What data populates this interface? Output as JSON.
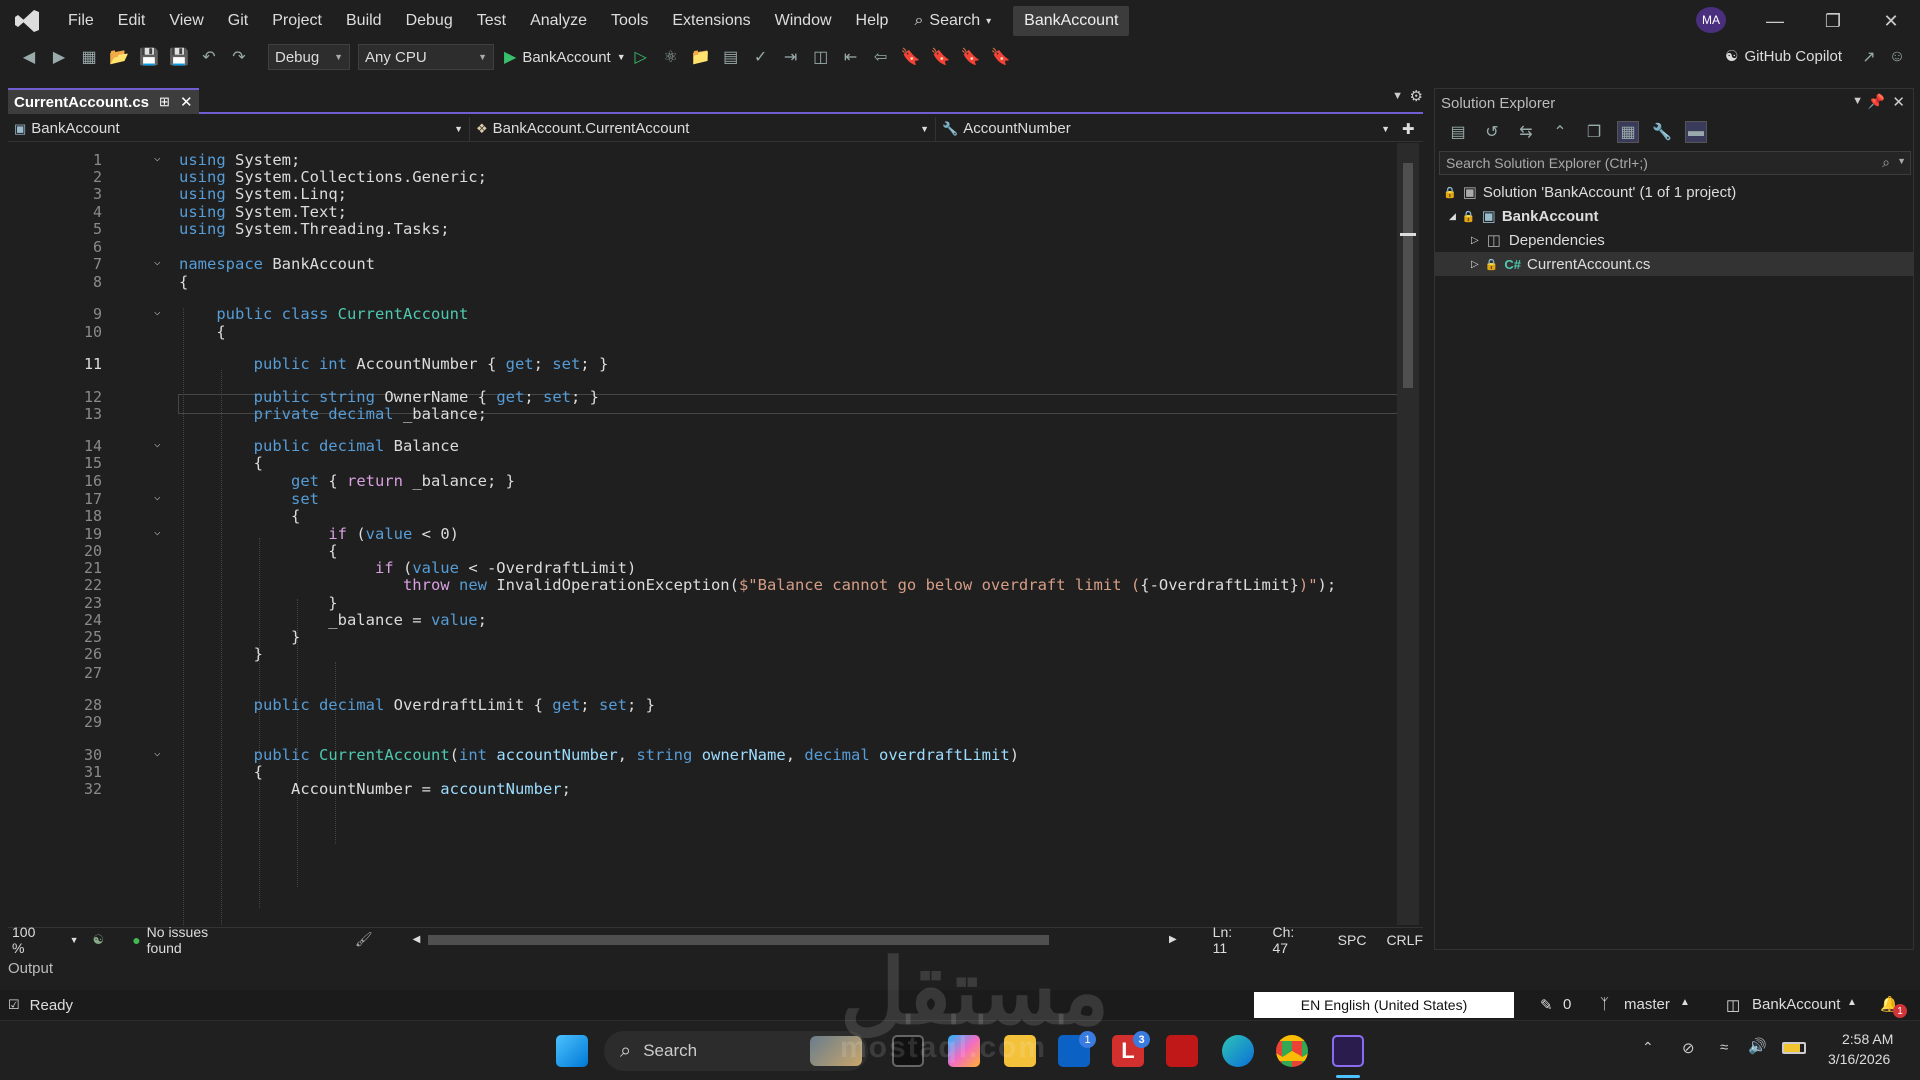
{
  "menu": {
    "items": [
      "File",
      "Edit",
      "View",
      "Git",
      "Project",
      "Build",
      "Debug",
      "Test",
      "Analyze",
      "Tools",
      "Extensions",
      "Window",
      "Help"
    ],
    "search_label": "Search",
    "solution_name": "BankAccount",
    "avatar_initials": "MA"
  },
  "toolbar": {
    "config": "Debug",
    "platform": "Any CPU",
    "run_target": "BankAccount",
    "copilot_label": "GitHub Copilot"
  },
  "editor": {
    "tab_title": "CurrentAccount.cs",
    "nav_project": "BankAccount",
    "nav_type": "BankAccount.CurrentAccount",
    "nav_member": "AccountNumber",
    "zoom": "100 %",
    "issues": "No issues found",
    "line": "Ln: 11",
    "column": "Ch: 47",
    "whitespace": "SPC",
    "line_endings": "CRLF",
    "current_line_number": 11
  },
  "code_lines": [
    {
      "n": 1,
      "fold": true,
      "tokens": [
        [
          "kw",
          "using"
        ],
        [
          "tx",
          " System;"
        ]
      ]
    },
    {
      "n": 2,
      "fold": false,
      "tokens": [
        [
          "kw",
          "using"
        ],
        [
          "tx",
          " System.Collections.Generic;"
        ]
      ]
    },
    {
      "n": 3,
      "fold": false,
      "tokens": [
        [
          "kw",
          "using"
        ],
        [
          "tx",
          " System.Linq;"
        ]
      ]
    },
    {
      "n": 4,
      "fold": false,
      "tokens": [
        [
          "kw",
          "using"
        ],
        [
          "tx",
          " System.Text;"
        ]
      ]
    },
    {
      "n": 5,
      "fold": false,
      "tokens": [
        [
          "kw",
          "using"
        ],
        [
          "tx",
          " System.Threading.Tasks;"
        ]
      ]
    },
    {
      "n": 6,
      "fold": false,
      "tokens": []
    },
    {
      "n": 7,
      "fold": true,
      "tokens": [
        [
          "kw",
          "namespace"
        ],
        [
          "tx",
          " BankAccount"
        ]
      ]
    },
    {
      "n": 8,
      "fold": false,
      "tokens": [
        [
          "tx",
          "{"
        ]
      ]
    },
    {
      "n": 9,
      "fold": true,
      "tokens": [
        [
          "tx",
          "    "
        ],
        [
          "kw",
          "public class"
        ],
        [
          "tx",
          " "
        ],
        [
          "ty",
          "CurrentAccount"
        ]
      ]
    },
    {
      "n": 10,
      "fold": false,
      "tokens": [
        [
          "tx",
          "    {"
        ]
      ]
    },
    {
      "n": 11,
      "fold": false,
      "tokens": [
        [
          "tx",
          "        "
        ],
        [
          "kw",
          "public int"
        ],
        [
          "tx",
          " AccountNumber { "
        ],
        [
          "kw",
          "get"
        ],
        [
          "tx",
          "; "
        ],
        [
          "kw",
          "set"
        ],
        [
          "tx",
          "; }"
        ]
      ]
    },
    {
      "n": 12,
      "fold": false,
      "tokens": [
        [
          "tx",
          "        "
        ],
        [
          "kw",
          "public string"
        ],
        [
          "tx",
          " OwnerName { "
        ],
        [
          "kw",
          "get"
        ],
        [
          "tx",
          "; "
        ],
        [
          "kw",
          "set"
        ],
        [
          "tx",
          "; }"
        ]
      ]
    },
    {
      "n": 13,
      "fold": false,
      "tokens": [
        [
          "tx",
          "        "
        ],
        [
          "kw",
          "private decimal"
        ],
        [
          "tx",
          " _balance;"
        ]
      ]
    },
    {
      "n": 14,
      "fold": true,
      "tokens": [
        [
          "tx",
          "        "
        ],
        [
          "kw",
          "public decimal"
        ],
        [
          "tx",
          " Balance"
        ]
      ]
    },
    {
      "n": 15,
      "fold": false,
      "tokens": [
        [
          "tx",
          "        {"
        ]
      ]
    },
    {
      "n": 16,
      "fold": false,
      "tokens": [
        [
          "tx",
          "            "
        ],
        [
          "kw",
          "get"
        ],
        [
          "tx",
          " { "
        ],
        [
          "cf",
          "return"
        ],
        [
          "tx",
          " _balance; }"
        ]
      ]
    },
    {
      "n": 17,
      "fold": true,
      "tokens": [
        [
          "tx",
          "            "
        ],
        [
          "kw",
          "set"
        ]
      ]
    },
    {
      "n": 18,
      "fold": false,
      "tokens": [
        [
          "tx",
          "            {"
        ]
      ]
    },
    {
      "n": 19,
      "fold": true,
      "tokens": [
        [
          "tx",
          "                "
        ],
        [
          "cf",
          "if"
        ],
        [
          "tx",
          " ("
        ],
        [
          "kw",
          "value"
        ],
        [
          "tx",
          " < 0)"
        ]
      ]
    },
    {
      "n": 20,
      "fold": false,
      "tokens": [
        [
          "tx",
          "                {"
        ]
      ]
    },
    {
      "n": 21,
      "fold": false,
      "tokens": [
        [
          "tx",
          "                     "
        ],
        [
          "cf",
          "if"
        ],
        [
          "tx",
          " ("
        ],
        [
          "kw",
          "value"
        ],
        [
          "tx",
          " < -OverdraftLimit)"
        ]
      ]
    },
    {
      "n": 22,
      "fold": false,
      "tokens": [
        [
          "tx",
          "                        "
        ],
        [
          "cf",
          "throw"
        ],
        [
          "tx",
          " "
        ],
        [
          "kw",
          "new"
        ],
        [
          "tx",
          " InvalidOperationException("
        ],
        [
          "st",
          "$\"Balance cannot go below overdraft limit ("
        ],
        [
          "tx",
          "{-OverdraftLimit}"
        ],
        [
          "st",
          ")\""
        ],
        [
          "tx",
          ");"
        ]
      ]
    },
    {
      "n": 23,
      "fold": false,
      "tokens": [
        [
          "tx",
          "                }"
        ]
      ]
    },
    {
      "n": 24,
      "fold": false,
      "tokens": [
        [
          "tx",
          "                _balance = "
        ],
        [
          "kw",
          "value"
        ],
        [
          "tx",
          ";"
        ]
      ]
    },
    {
      "n": 25,
      "fold": false,
      "tokens": [
        [
          "tx",
          "            }"
        ]
      ]
    },
    {
      "n": 26,
      "fold": false,
      "tokens": [
        [
          "tx",
          "        }"
        ]
      ]
    },
    {
      "n": 27,
      "fold": false,
      "tokens": []
    },
    {
      "n": 28,
      "fold": false,
      "tokens": [
        [
          "tx",
          "        "
        ],
        [
          "kw",
          "public decimal"
        ],
        [
          "tx",
          " OverdraftLimit { "
        ],
        [
          "kw",
          "get"
        ],
        [
          "tx",
          "; "
        ],
        [
          "kw",
          "set"
        ],
        [
          "tx",
          "; }"
        ]
      ]
    },
    {
      "n": 29,
      "fold": false,
      "tokens": []
    },
    {
      "n": 30,
      "fold": true,
      "tokens": [
        [
          "tx",
          "        "
        ],
        [
          "kw",
          "public"
        ],
        [
          "tx",
          " "
        ],
        [
          "ty",
          "CurrentAccount"
        ],
        [
          "tx",
          "("
        ],
        [
          "kw",
          "int"
        ],
        [
          "tx",
          " "
        ],
        [
          "pm",
          "accountNumber"
        ],
        [
          "tx",
          ", "
        ],
        [
          "kw",
          "string"
        ],
        [
          "tx",
          " "
        ],
        [
          "pm",
          "ownerName"
        ],
        [
          "tx",
          ", "
        ],
        [
          "kw",
          "decimal"
        ],
        [
          "tx",
          " "
        ],
        [
          "pm",
          "overdraftLimit"
        ],
        [
          "tx",
          ")"
        ]
      ]
    },
    {
      "n": 31,
      "fold": false,
      "tokens": [
        [
          "tx",
          "        {"
        ]
      ]
    },
    {
      "n": 32,
      "fold": false,
      "tokens": [
        [
          "tx",
          "            AccountNumber = "
        ],
        [
          "pm",
          "accountNumber"
        ],
        [
          "tx",
          ";"
        ]
      ]
    }
  ],
  "solution_explorer": {
    "title": "Solution Explorer",
    "search_placeholder": "Search Solution Explorer (Ctrl+;)",
    "solution_label": "Solution 'BankAccount' (1 of 1 project)",
    "project_label": "BankAccount",
    "dependencies_label": "Dependencies",
    "file_label": "CurrentAccount.cs"
  },
  "output": {
    "label": "Output"
  },
  "status": {
    "ready": "Ready",
    "language": "EN English (United States)",
    "errors": "0",
    "branch": "master",
    "repo": "BankAccount",
    "notifications": "1"
  },
  "taskbar": {
    "search_label": "Search",
    "time": "2:58 AM",
    "date": "3/16/2026",
    "store_badge": "1",
    "app_badge": "3"
  },
  "watermark": "مستقل",
  "watermark_sub": "mostaql.com"
}
